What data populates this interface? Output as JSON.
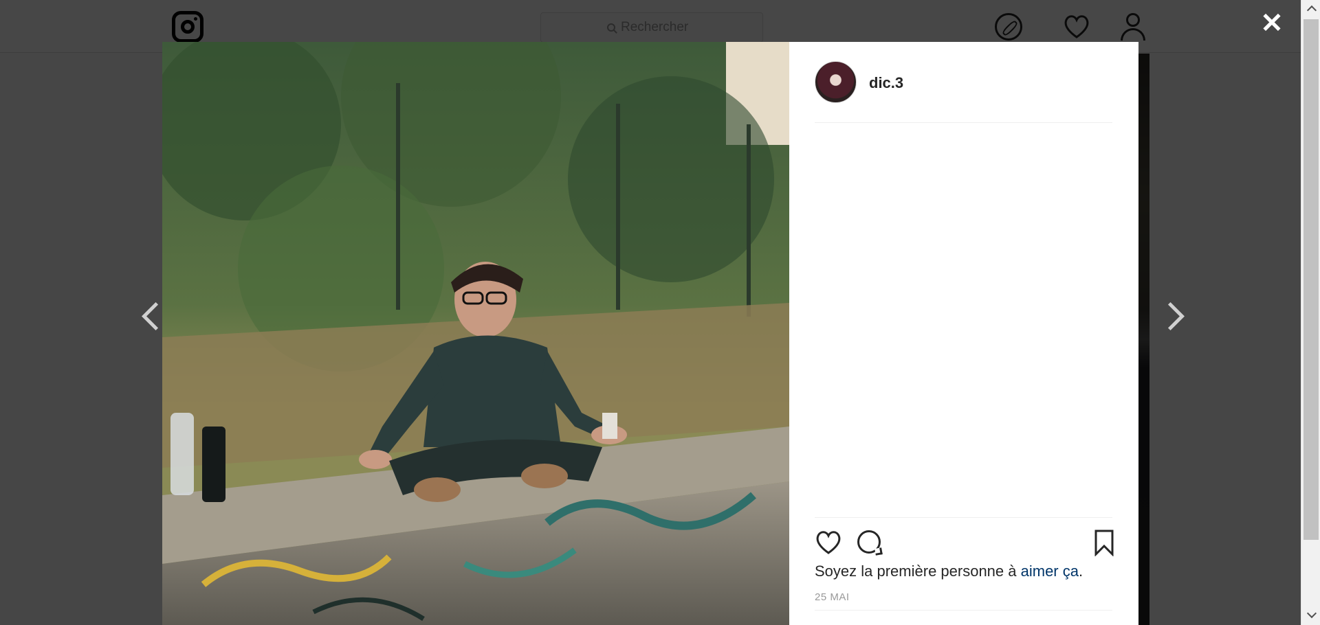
{
  "header": {
    "logo": "instagram-logo",
    "search_placeholder": "Rechercher",
    "icons": [
      "compass-icon",
      "heart-icon",
      "profile-icon"
    ]
  },
  "modal": {
    "close_label": "✕",
    "post": {
      "username": "dic.3",
      "likes_prefix": "Soyez la première personne à ",
      "likes_link": "aimer ça",
      "likes_suffix": ".",
      "date": "25 MAI"
    },
    "icons": [
      "heart-icon",
      "comment-icon",
      "bookmark-icon"
    ]
  },
  "colors": {
    "link": "#003569",
    "text": "#262626",
    "muted": "#999999",
    "overlay": "rgba(0,0,0,0.72)"
  }
}
